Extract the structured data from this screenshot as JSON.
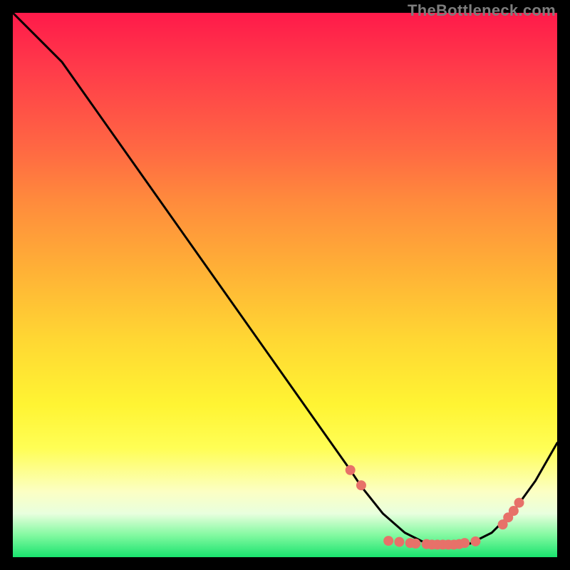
{
  "watermark": "TheBottleneck.com",
  "chart_data": {
    "type": "line",
    "title": "",
    "xlabel": "",
    "ylabel": "",
    "xlim": [
      0,
      100
    ],
    "ylim": [
      0,
      100
    ],
    "curve": [
      {
        "x": 0,
        "y": 100
      },
      {
        "x": 5,
        "y": 95
      },
      {
        "x": 9,
        "y": 91
      },
      {
        "x": 62,
        "y": 16
      },
      {
        "x": 64,
        "y": 13
      },
      {
        "x": 68,
        "y": 8
      },
      {
        "x": 72,
        "y": 4.5
      },
      {
        "x": 76,
        "y": 2.5
      },
      {
        "x": 80,
        "y": 2
      },
      {
        "x": 84,
        "y": 2.5
      },
      {
        "x": 88,
        "y": 4.5
      },
      {
        "x": 92,
        "y": 8.5
      },
      {
        "x": 96,
        "y": 14
      },
      {
        "x": 100,
        "y": 21
      }
    ],
    "dots": [
      {
        "x": 62,
        "y": 16
      },
      {
        "x": 64,
        "y": 13.2
      },
      {
        "x": 69,
        "y": 3.0
      },
      {
        "x": 71,
        "y": 2.8
      },
      {
        "x": 73,
        "y": 2.6
      },
      {
        "x": 74,
        "y": 2.5
      },
      {
        "x": 76,
        "y": 2.4
      },
      {
        "x": 77,
        "y": 2.3
      },
      {
        "x": 78,
        "y": 2.3
      },
      {
        "x": 79,
        "y": 2.3
      },
      {
        "x": 80,
        "y": 2.3
      },
      {
        "x": 81,
        "y": 2.3
      },
      {
        "x": 82,
        "y": 2.4
      },
      {
        "x": 83,
        "y": 2.6
      },
      {
        "x": 85,
        "y": 2.9
      },
      {
        "x": 90,
        "y": 6.0
      },
      {
        "x": 91,
        "y": 7.3
      },
      {
        "x": 92,
        "y": 8.5
      },
      {
        "x": 93,
        "y": 10.0
      }
    ]
  }
}
